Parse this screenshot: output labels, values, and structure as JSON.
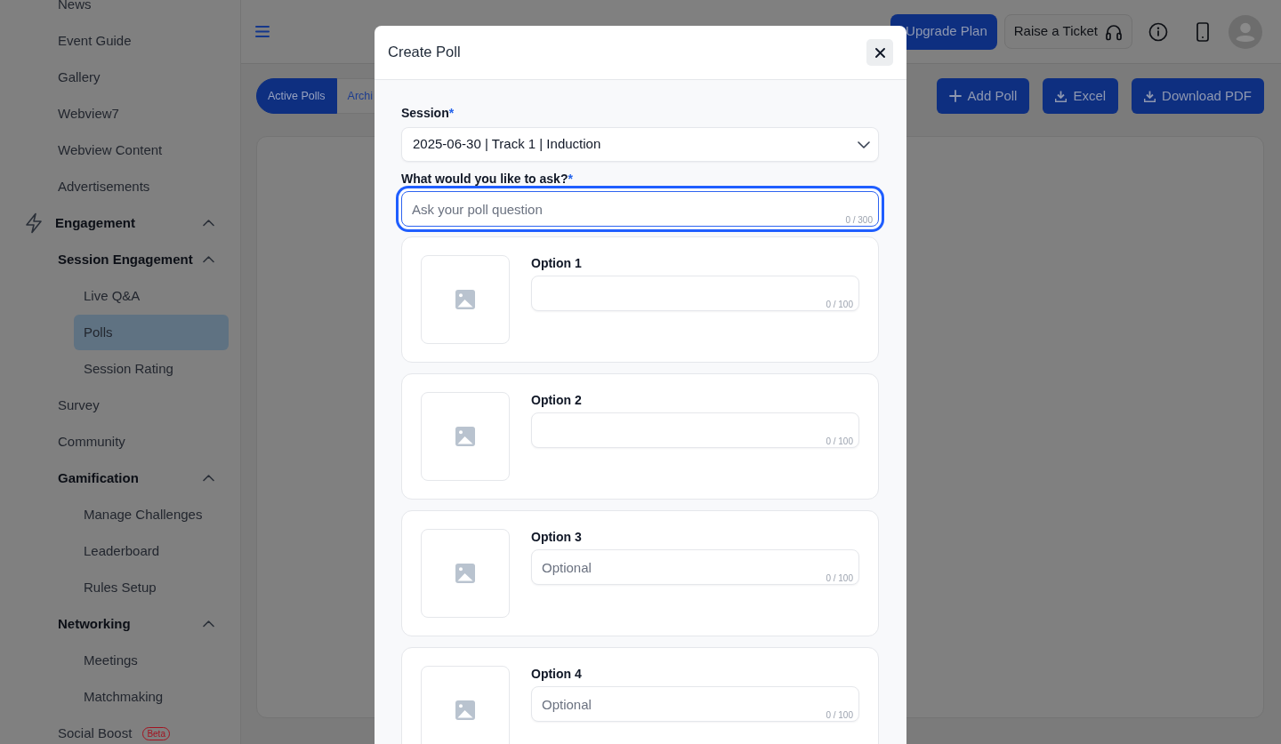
{
  "sidebar": {
    "groups": [
      {
        "children": [
          {
            "label": "News",
            "selected": false
          },
          {
            "label": "Event Guide",
            "selected": false
          },
          {
            "label": "Gallery",
            "selected": false
          },
          {
            "label": "Webview7",
            "selected": false
          },
          {
            "label": "Webview Content",
            "selected": false
          },
          {
            "label": "Advertisements",
            "selected": false
          }
        ]
      },
      {
        "label": "Engagement",
        "selected": false,
        "expanded": true,
        "children": [
          {
            "label": "Session Engagement",
            "selected": false,
            "expanded": true,
            "children": [
              {
                "label": "Live Q&A",
                "selected": false
              },
              {
                "label": "Polls",
                "selected": true
              },
              {
                "label": "Session Rating",
                "selected": false
              }
            ]
          },
          {
            "label": "Survey",
            "selected": false
          },
          {
            "label": "Community",
            "selected": false
          },
          {
            "label": "Gamification",
            "selected": false,
            "expanded": true,
            "children": [
              {
                "label": "Manage Challenges",
                "selected": false
              },
              {
                "label": "Leaderboard",
                "selected": false
              },
              {
                "label": "Rules Setup",
                "selected": false
              }
            ]
          },
          {
            "label": "Networking",
            "selected": false,
            "expanded": true,
            "children": [
              {
                "label": "Meetings",
                "selected": false
              },
              {
                "label": "Matchmaking",
                "selected": false
              }
            ]
          },
          {
            "label": "Social Boost",
            "selected": false,
            "badge": "Beta"
          }
        ]
      }
    ]
  },
  "header": {
    "buttons": [
      {
        "kind": "primary",
        "label": "Upgrade Plan"
      },
      {
        "kind": "secondary",
        "label": "Raise a Ticket"
      }
    ]
  },
  "tabs": [
    {
      "label": "Active Polls",
      "selected": true
    },
    {
      "label": "Archi",
      "selected": false
    }
  ],
  "actions": [
    {
      "kind": "add",
      "label": "Add Poll"
    },
    {
      "kind": "download",
      "label": "Excel"
    },
    {
      "kind": "download",
      "label": "Download PDF"
    }
  ],
  "modal": {
    "title": "Create Poll",
    "session": {
      "label": "Session",
      "required_mark": "*",
      "value": "2025-06-30 | Track 1 | Induction"
    },
    "question": {
      "label": "What would you like to ask?",
      "required_mark": "*",
      "placeholder": "Ask your poll question",
      "counter": "0 / 300",
      "focused": true
    },
    "options": [
      {
        "label": "Option 1",
        "counter": "0 / 100"
      },
      {
        "label": "Option 2",
        "counter": "0 / 100"
      },
      {
        "label": "Option 3",
        "placeholder": "Optional",
        "counter": "0 / 100"
      },
      {
        "label": "Option 4",
        "placeholder": "Optional",
        "counter": "0 / 100"
      }
    ]
  }
}
